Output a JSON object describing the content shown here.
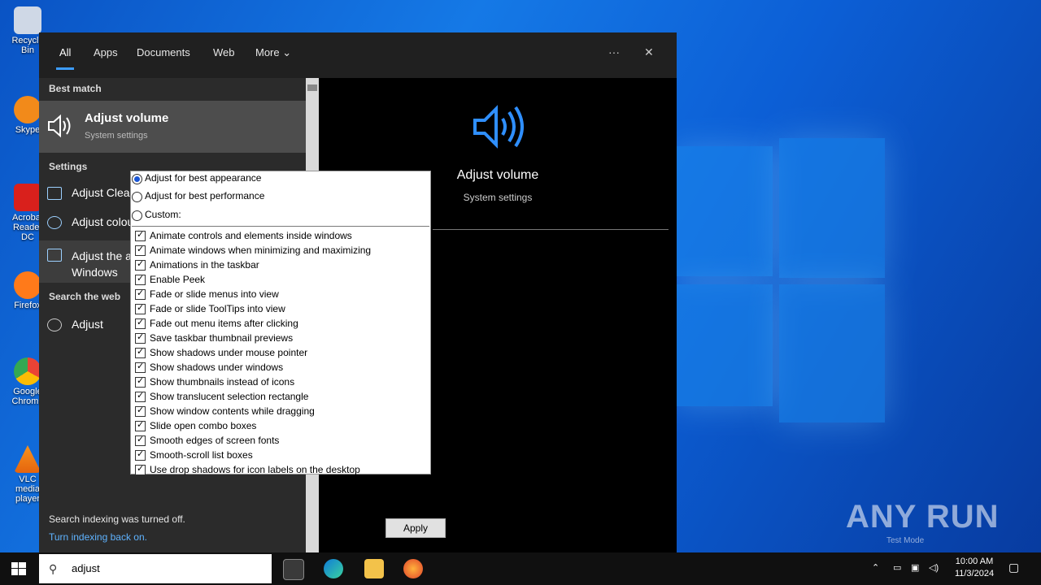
{
  "desktop": {
    "icons": [
      {
        "label": "Recycle Bin"
      },
      {
        "label": "Skype"
      },
      {
        "label": "Acrobat Reader DC"
      },
      {
        "label": "Firefox"
      },
      {
        "label": "Google Chrome"
      },
      {
        "label": "VLC media player"
      }
    ]
  },
  "search": {
    "tabs": [
      "All",
      "Apps",
      "Documents",
      "Web",
      "More"
    ],
    "best_match_label": "Best match",
    "best_match": {
      "title": "Adjust volume",
      "subtitle": "System settings"
    },
    "settings_label": "Settings",
    "settings_items": [
      "Adjust ClearType text",
      "Adjust colour",
      "Adjust the appearance and performance of Windows"
    ],
    "web_label": "Search the web",
    "web_item": "Adjust",
    "footer_text": "Search indexing was turned off.",
    "footer_link": "Turn indexing back on."
  },
  "preview": {
    "title": "Adjust volume",
    "subtitle": "System settings"
  },
  "performance": {
    "radios": [
      {
        "label": "Adjust for best appearance",
        "selected": true
      },
      {
        "label": "Adjust for best performance",
        "selected": false
      },
      {
        "label": "Custom:",
        "selected": false
      }
    ],
    "options": [
      "Animate controls and elements inside windows",
      "Animate windows when minimizing and maximizing",
      "Animations in the taskbar",
      "Enable Peek",
      "Fade or slide menus into view",
      "Fade or slide ToolTips into view",
      "Fade out menu items after clicking",
      "Save taskbar thumbnail previews",
      "Show shadows under mouse pointer",
      "Show shadows under windows",
      "Show thumbnails instead of icons",
      "Show translucent selection rectangle",
      "Show window contents while dragging",
      "Slide open combo boxes",
      "Smooth edges of screen fonts",
      "Smooth-scroll list boxes",
      "Use drop shadows for icon labels on the desktop"
    ],
    "apply_label": "Apply"
  },
  "taskbar": {
    "search_value": "adjust",
    "time": "10:00 AM",
    "date": "11/3/2024"
  },
  "watermark": {
    "text": "ANY RUN",
    "subtext": "Test Mode"
  },
  "colors": {
    "accent": "#3c9cff",
    "desktop": "#1579e6"
  }
}
